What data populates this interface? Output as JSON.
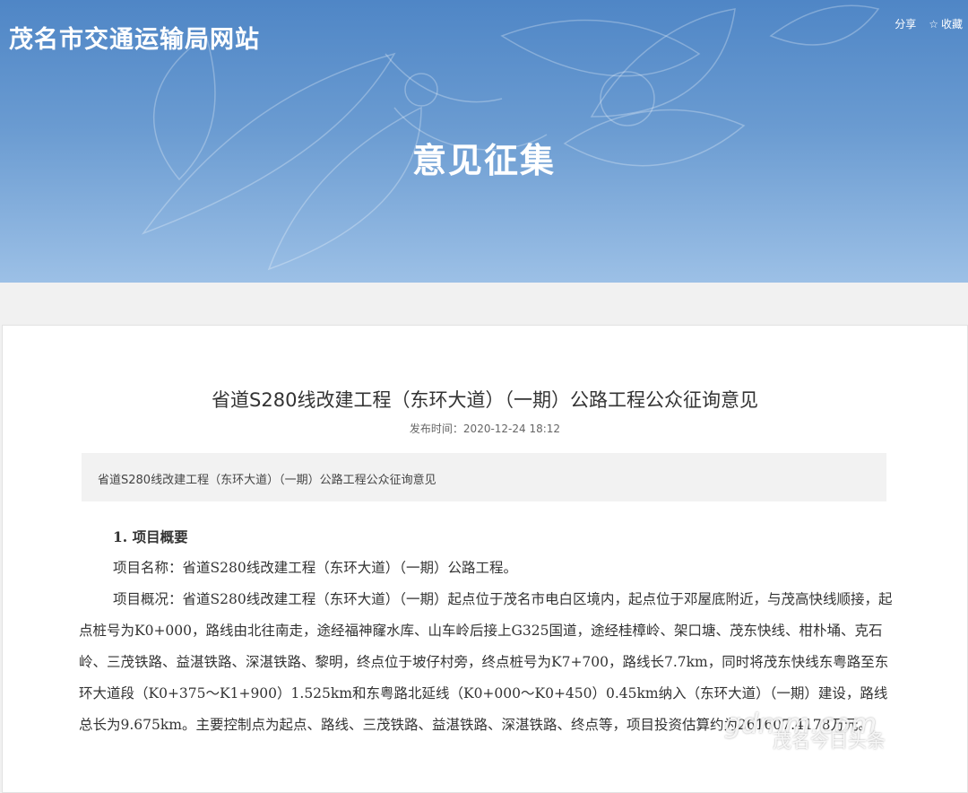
{
  "header": {
    "site_title": "茂名市交通运输局网站",
    "share_label": "分享",
    "favorite_label": "收藏",
    "section_title": "意见征集"
  },
  "article": {
    "title": "省道S280线改建工程（东环大道）（一期）公路工程公众征询意见",
    "pub_time": "发布时间：2020-12-24 18:12",
    "summary": "省道S280线改建工程（东环大道）（一期）公路工程公众征询意见",
    "heading1": "1. 项目概要",
    "para1": "项目名称：省道S280线改建工程（东环大道）（一期）公路工程。",
    "para2": "项目概况：省道S280线改建工程（东环大道）（一期）起点位于茂名市电白区境内，起点位于邓屋底附近，与茂高快线顺接，起点桩号为K0+000，路线由北往南走，途经福神窿水库、山车岭后接上G325国道，途经桂樟岭、架口塘、茂东快线、柑朴埇、克石岭、三茂铁路、益湛铁路、深湛铁路、黎明，终点位于坡仔村旁，终点桩号为K7+700，路线长7.7km，同时将茂东快线东粤路至东环大道段（K0+375～K1+900）1.525km和东粤路北延线（K0+000～K0+450）0.45km纳入（东环大道）（一期）建设，路线总长为9.675km。主要控制点为起点、路线、三茂铁路、益湛铁路、深湛铁路、终点等，项目投资估算约为261607.4178万元。"
  },
  "watermark": {
    "main": "gdmm.com",
    "sub": "茂名今日头条"
  }
}
